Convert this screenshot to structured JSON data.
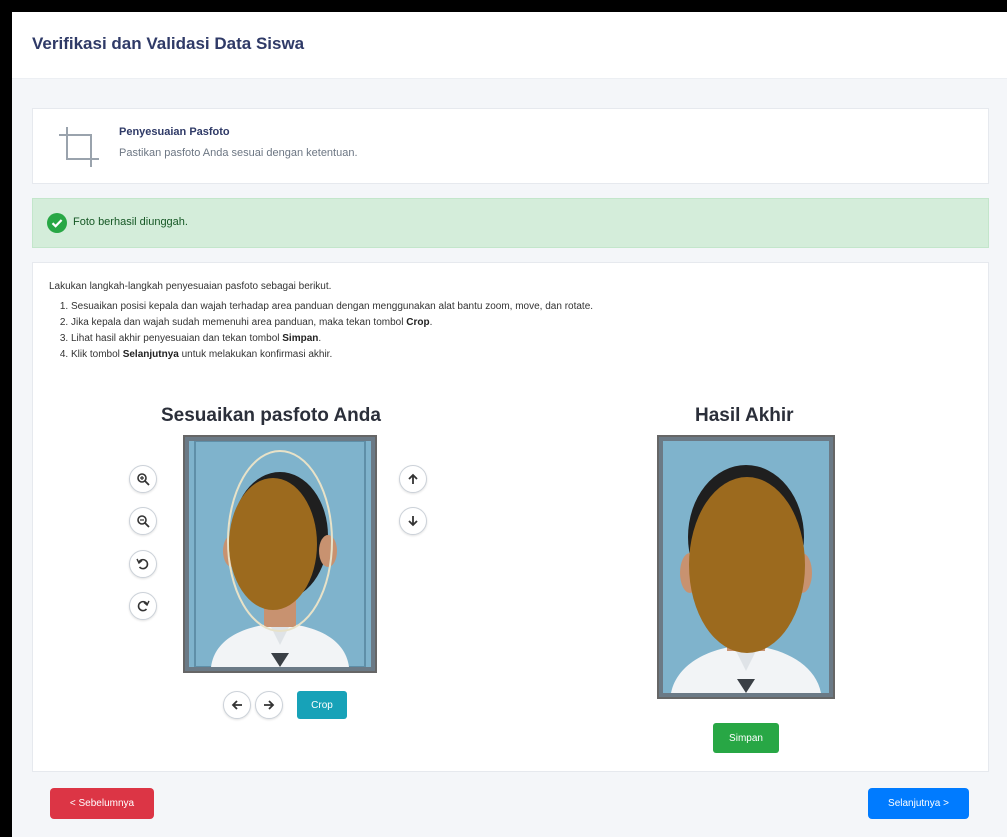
{
  "header": {
    "title": "Verifikasi dan Validasi Data Siswa"
  },
  "step": {
    "icon": "crop-icon",
    "title": "Penyesuaian Pasfoto",
    "description": "Pastikan pasfoto Anda sesuai dengan ketentuan."
  },
  "alert": {
    "icon": "check-circle-icon",
    "text": "Foto berhasil diunggah.",
    "color": "#28a745"
  },
  "instructions": {
    "intro": "Lakukan langkah-langkah penyesuaian pasfoto sebagai berikut.",
    "step1": "Sesuaikan posisi kepala dan wajah terhadap area panduan dengan menggunakan alat bantu zoom, move, dan rotate.",
    "step2_prefix": "Jika kepala dan wajah sudah memenuhi area panduan, maka tekan tombol ",
    "step2_bold": "Crop",
    "step2_suffix": ".",
    "step3_prefix": "Lihat hasil akhir penyesuaian dan tekan tombol ",
    "step3_bold": "Simpan",
    "step3_suffix": ".",
    "step4_prefix": "Klik tombol ",
    "step4_bold": "Selanjutnya",
    "step4_suffix": " untuk melakukan konfirmasi akhir."
  },
  "adjust": {
    "title": "Sesuaikan pasfoto Anda",
    "tools": {
      "zoom_in": "zoom-in-icon",
      "zoom_out": "zoom-out-icon",
      "rotate_left": "rotate-left-icon",
      "rotate_right": "rotate-right-icon",
      "move_up": "arrow-up-icon",
      "move_down": "arrow-down-icon",
      "move_left": "arrow-left-icon",
      "move_right": "arrow-right-icon"
    },
    "crop_label": "Crop",
    "crop_color": "#17a2b8"
  },
  "result": {
    "title": "Hasil Akhir",
    "save_label": "Simpan",
    "save_color": "#28a745"
  },
  "footer": {
    "prev_label": "< Sebelumnya",
    "next_label": "Selanjutnya >",
    "prev_color": "#dc3545",
    "next_color": "#007bff"
  },
  "colors": {
    "photo_background": "#7fb3cc",
    "face_mask": "#9c6a1e",
    "title_text": "#2f3a67"
  }
}
